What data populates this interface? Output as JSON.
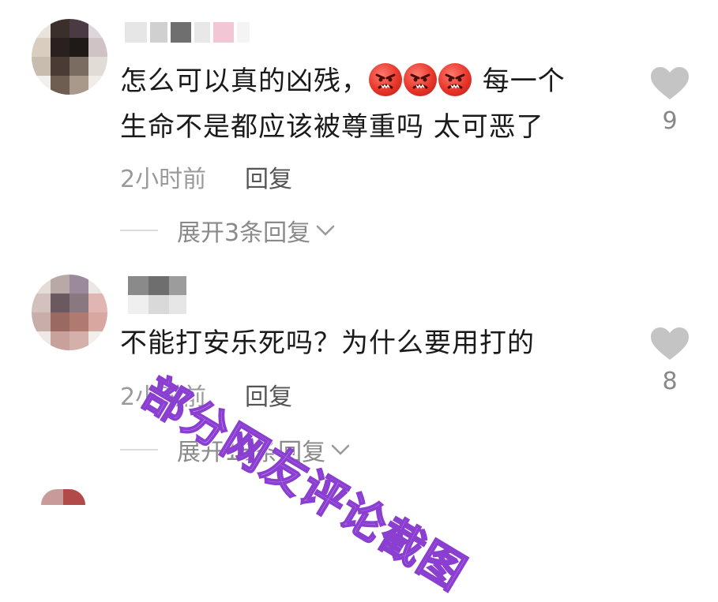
{
  "comments": [
    {
      "text_line1": "怎么可以真的凶残，",
      "text_line1_tail": " 每一个",
      "text_line2": "生命不是都应该被尊重吗 太可恶了",
      "emojis": [
        "angry-face-emoji",
        "angry-face-emoji",
        "angry-face-emoji"
      ],
      "time": "2小时前",
      "reply_label": "回复",
      "expand_label": "展开3条回复",
      "likes": "9"
    },
    {
      "text_line1": "不能打安乐死吗？为什么要用打的",
      "time": "2小时前",
      "reply_label": "回复",
      "expand_label": "展开15条回复",
      "likes": "8"
    }
  ],
  "watermark": "部分网友评论截图",
  "colors": {
    "text": "#1a1a1a",
    "meta": "#9a9a9a",
    "heart": "#c4c4c4",
    "watermark_fill": "#c38ff5",
    "watermark_stroke": "#8a3fd0"
  },
  "icons": {
    "like": "heart-icon",
    "expand": "chevron-down-icon"
  }
}
